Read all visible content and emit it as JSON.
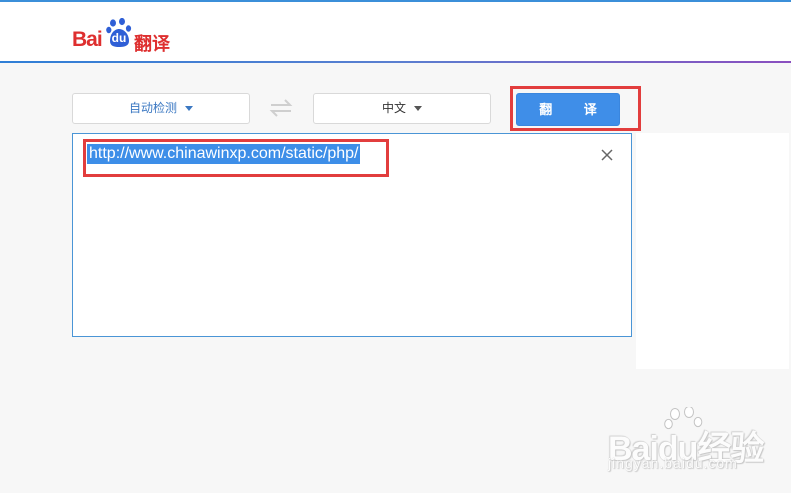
{
  "header": {
    "logo": {
      "bai": "Bai",
      "du": "du",
      "suffix": "翻译"
    }
  },
  "toolbar": {
    "source_language": "自动检测",
    "target_language": "中文",
    "translate_label": "翻 译"
  },
  "input": {
    "text": "http://www.chinawinxp.com/static/php/"
  },
  "watermark": {
    "brand": "Baidu经验",
    "url": "jingyan.baidu.com"
  },
  "colors": {
    "brand_red": "#de2f2f",
    "accent_blue": "#3f8ee8",
    "highlight_red": "#e23d3d"
  }
}
